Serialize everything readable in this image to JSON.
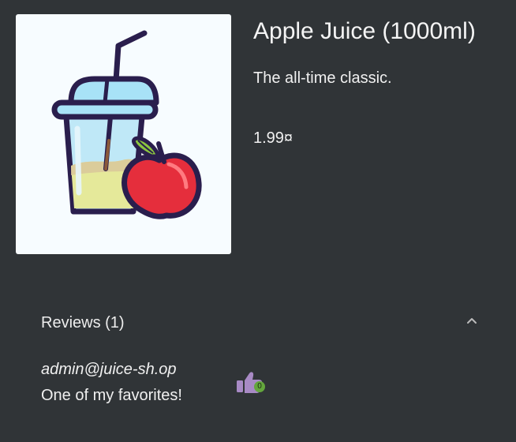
{
  "product": {
    "title": "Apple Juice (1000ml)",
    "description": "The all-time classic.",
    "price": "1.99¤",
    "image_icon": "apple-juice-cup-icon"
  },
  "reviews": {
    "header_label": "Reviews (1)",
    "expanded": true,
    "items": [
      {
        "author": "admin@juice-sh.op",
        "message": "One of my favorites!",
        "likes": "0"
      }
    ]
  },
  "colors": {
    "background": "#303437",
    "text": "#f1f1f1",
    "thumb_icon": "#a88ac5",
    "like_badge": "#64a63d"
  }
}
